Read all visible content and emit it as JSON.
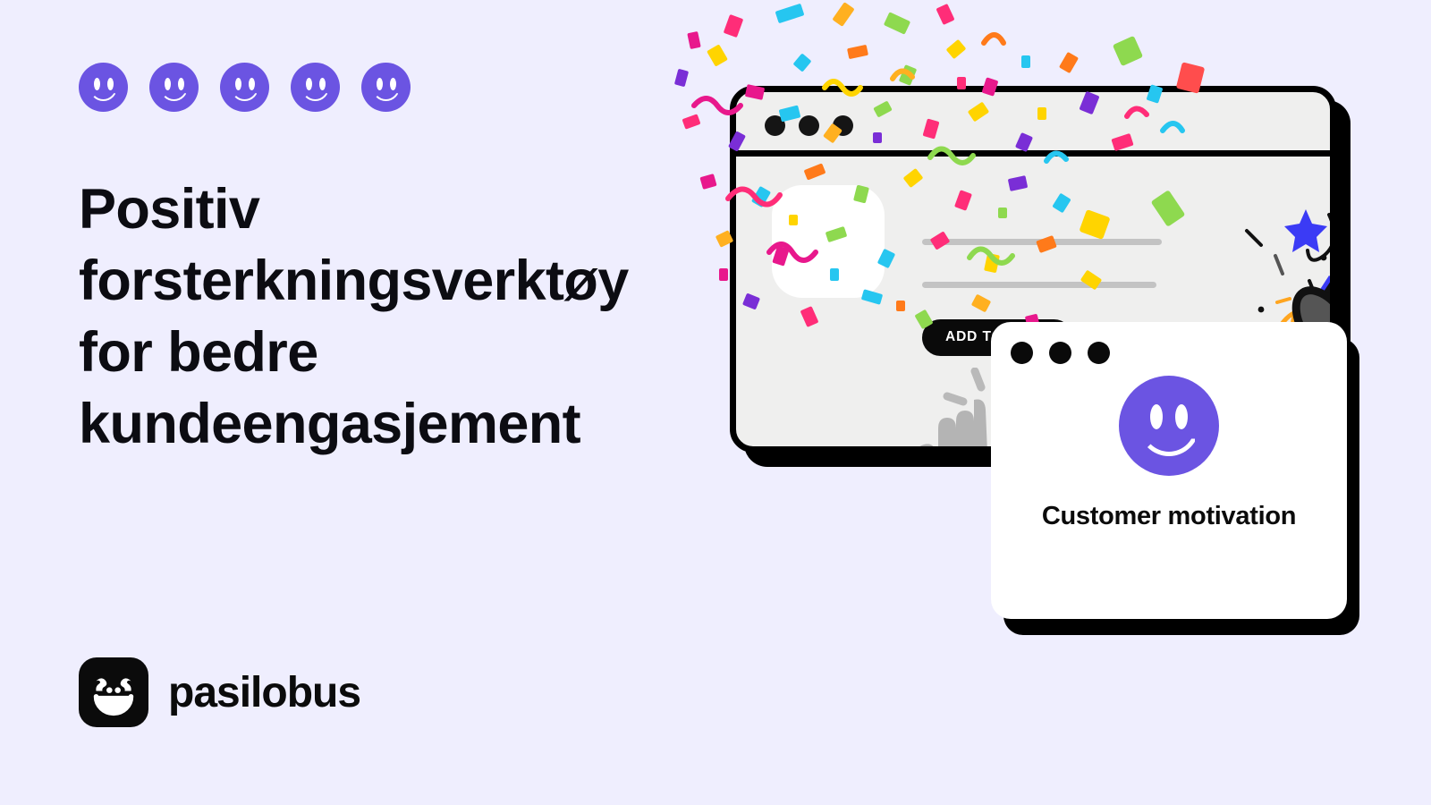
{
  "theme": {
    "background": "#efeefe",
    "accent_purple": "#6b54e2",
    "ink": "#0b0b0b",
    "popper_blue": "#3b3bf5",
    "panel_gray": "#efefee",
    "line_gray": "#c3c3c3",
    "hand_gray": "#b4b4b4"
  },
  "left": {
    "smileys": [
      {
        "name": "smiley-1",
        "color": "#6b54e2"
      },
      {
        "name": "smiley-2",
        "color": "#6b54e2"
      },
      {
        "name": "smiley-3",
        "color": "#6b54e2"
      },
      {
        "name": "smiley-4",
        "color": "#6b54e2"
      },
      {
        "name": "smiley-5",
        "color": "#6b54e2"
      }
    ],
    "headline": "Positiv forsterkningsverktøy for bedre kundeengasjement",
    "logo": {
      "wordmark": "pasilobus",
      "mark_icon": "smiley-logo-icon"
    }
  },
  "illustration": {
    "browser": {
      "traffic_lights": [
        "dot-red",
        "dot-yellow",
        "dot-green"
      ],
      "product_image_placeholder": "product-thumbnail",
      "text_lines": [
        "line-1",
        "line-2"
      ],
      "cta_label": "ADD TO CART",
      "cursor_icon": "pointing-hand-cursor-icon",
      "popper_icon": "party-popper-icon"
    },
    "card": {
      "traffic_lights": [
        "dot-1",
        "dot-2",
        "dot-3"
      ],
      "icon": "smiley-face-icon",
      "icon_color": "#6b54e2",
      "title": "Customer motivation"
    },
    "confetti": {
      "colors": [
        "#ff2d78",
        "#e8188c",
        "#26c6f0",
        "#00b3e6",
        "#6cd34a",
        "#8ed94f",
        "#ffd400",
        "#ffb020",
        "#ff7a1a",
        "#7a2ed6",
        "#3b3bf5",
        "#111111",
        "#ff4d4d"
      ],
      "star_colors": [
        "#3b3bf5",
        "#ffa51f",
        "#111111"
      ],
      "description": "colorful confetti burst"
    }
  }
}
